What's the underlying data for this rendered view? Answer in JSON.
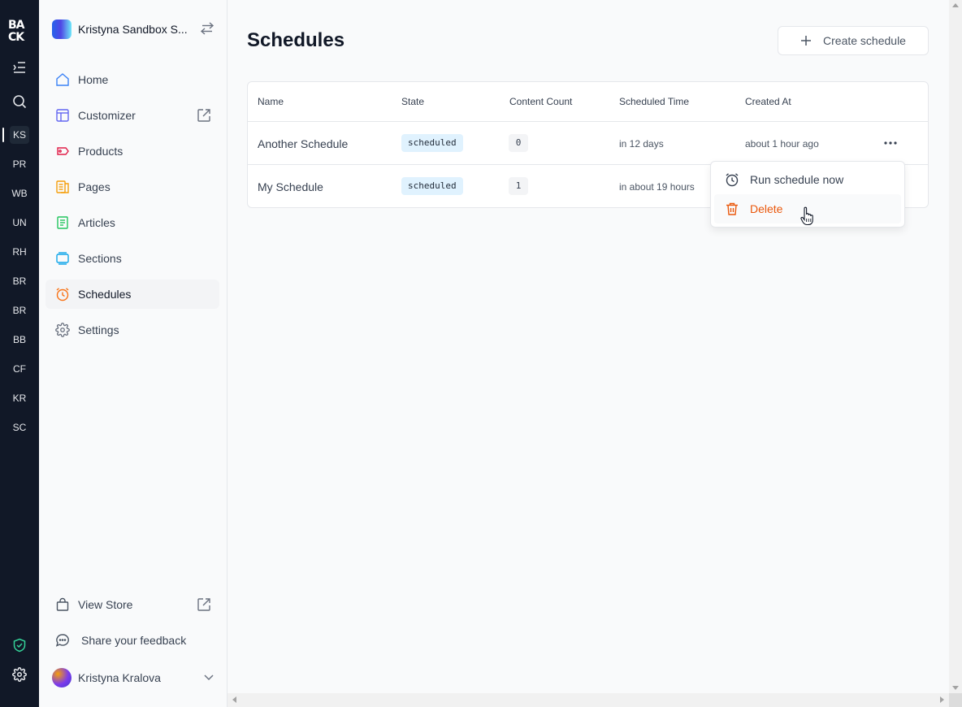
{
  "rail": {
    "logo": "BACK",
    "workspaces": [
      {
        "label": "KS",
        "active": true
      },
      {
        "label": "PR"
      },
      {
        "label": "WB"
      },
      {
        "label": "UN"
      },
      {
        "label": "RH"
      },
      {
        "label": "BR"
      },
      {
        "label": "BR"
      },
      {
        "label": "BB"
      },
      {
        "label": "CF"
      },
      {
        "label": "KR"
      },
      {
        "label": "SC"
      }
    ]
  },
  "sidebar": {
    "org_name": "Kristyna Sandbox S...",
    "items": [
      {
        "label": "Home",
        "icon": "home-icon"
      },
      {
        "label": "Customizer",
        "icon": "layout-icon"
      },
      {
        "label": "Products",
        "icon": "tag-icon"
      },
      {
        "label": "Pages",
        "icon": "pages-icon"
      },
      {
        "label": "Articles",
        "icon": "articles-icon"
      },
      {
        "label": "Sections",
        "icon": "sections-icon"
      },
      {
        "label": "Schedules",
        "icon": "clock-icon",
        "active": true
      },
      {
        "label": "Settings",
        "icon": "gear-icon"
      }
    ],
    "view_store": "View Store",
    "feedback": "Share your feedback",
    "user_name": "Kristyna Kralova"
  },
  "main": {
    "title": "Schedules",
    "create_label": "Create schedule",
    "columns": [
      "Name",
      "State",
      "Content Count",
      "Scheduled Time",
      "Created At"
    ],
    "rows": [
      {
        "name": "Another Schedule",
        "state": "scheduled",
        "count": "0",
        "scheduled_time": "in 12 days",
        "created_at": "about 1 hour ago"
      },
      {
        "name": "My Schedule",
        "state": "scheduled",
        "count": "1",
        "scheduled_time": "in about 19 hours",
        "created_at": ""
      }
    ],
    "menu": {
      "run": "Run schedule now",
      "delete": "Delete"
    }
  },
  "colors": {
    "rail_bg": "#111827",
    "badge_bg": "#e0f2fe",
    "delete_text": "#ea580c",
    "active_nav_bg": "#f3f4f6"
  }
}
